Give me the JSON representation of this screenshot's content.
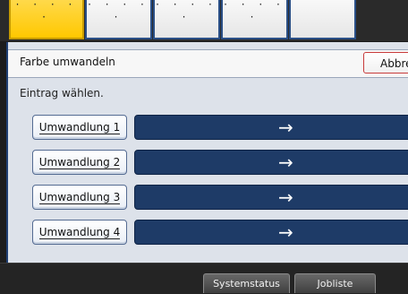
{
  "tabs": [
    {
      "state": "active",
      "marker": "· · · · ·"
    },
    {
      "state": "normal",
      "marker": "· · · · ·"
    },
    {
      "state": "normal",
      "marker": "· · · · ·"
    },
    {
      "state": "normal",
      "marker": "· · · · ·"
    },
    {
      "state": "normal",
      "marker": ""
    }
  ],
  "header": {
    "title": "Farbe umwandeln",
    "cancel_label": "Abbre"
  },
  "instruction": "Eintrag wählen.",
  "conversions": [
    {
      "label": "Umwandlung 1",
      "arrow": "→"
    },
    {
      "label": "Umwandlung 2",
      "arrow": "→"
    },
    {
      "label": "Umwandlung 3",
      "arrow": "→"
    },
    {
      "label": "Umwandlung 4",
      "arrow": "→"
    }
  ],
  "bottom": {
    "systemstatus_label": "Systemstatus",
    "jobliste_label": "Jobliste"
  },
  "colors": {
    "accent_tab": "#ffc800",
    "bar_blue": "#1e3b67",
    "cancel_border": "#c83b3b"
  }
}
